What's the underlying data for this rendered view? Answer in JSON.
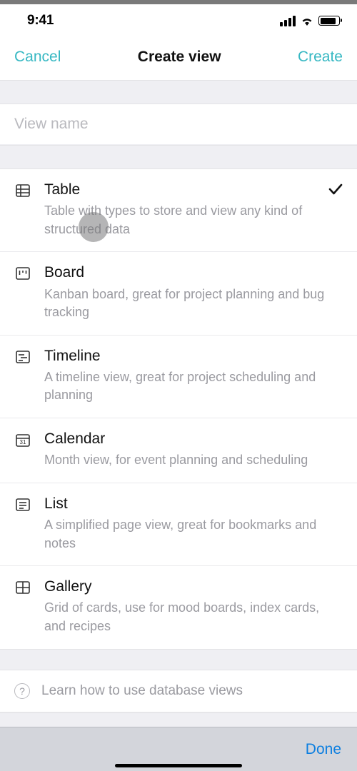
{
  "status": {
    "time": "9:41"
  },
  "nav": {
    "cancel": "Cancel",
    "title": "Create view",
    "create": "Create"
  },
  "input": {
    "placeholder": "View name",
    "value": ""
  },
  "options": [
    {
      "id": "table",
      "title": "Table",
      "desc": "Table with types to store and view any kind of structured data",
      "selected": true
    },
    {
      "id": "board",
      "title": "Board",
      "desc": "Kanban board, great for project planning and bug tracking",
      "selected": false
    },
    {
      "id": "timeline",
      "title": "Timeline",
      "desc": "A timeline view, great for project scheduling and planning",
      "selected": false
    },
    {
      "id": "calendar",
      "title": "Calendar",
      "desc": "Month view, for event planning and scheduling",
      "selected": false
    },
    {
      "id": "list",
      "title": "List",
      "desc": "A simplified page view, great for bookmarks and notes",
      "selected": false
    },
    {
      "id": "gallery",
      "title": "Gallery",
      "desc": "Grid of cards, use for mood boards, index cards, and recipes",
      "selected": false
    }
  ],
  "learn": {
    "label": "Learn how to use database views"
  },
  "keyboard": {
    "done": "Done"
  },
  "colors": {
    "accent": "#37b8c3",
    "doneBlue": "#0d7fe0"
  }
}
